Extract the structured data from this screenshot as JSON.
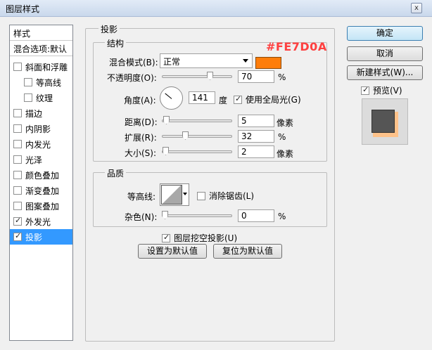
{
  "window": {
    "title": "图层样式",
    "close_label": "x"
  },
  "style_list": {
    "header": "样式",
    "blend_options": "混合选项:默认",
    "items": [
      {
        "label": "斜面和浮雕",
        "checked": false,
        "indent": false
      },
      {
        "label": "等高线",
        "checked": false,
        "indent": true
      },
      {
        "label": "纹理",
        "checked": false,
        "indent": true
      },
      {
        "label": "描边",
        "checked": false,
        "indent": false
      },
      {
        "label": "内阴影",
        "checked": false,
        "indent": false
      },
      {
        "label": "内发光",
        "checked": false,
        "indent": false
      },
      {
        "label": "光泽",
        "checked": false,
        "indent": false
      },
      {
        "label": "颜色叠加",
        "checked": false,
        "indent": false
      },
      {
        "label": "渐变叠加",
        "checked": false,
        "indent": false
      },
      {
        "label": "图案叠加",
        "checked": false,
        "indent": false
      },
      {
        "label": "外发光",
        "checked": true,
        "indent": false
      },
      {
        "label": "投影",
        "checked": true,
        "indent": false,
        "selected": true
      }
    ]
  },
  "panel": {
    "title": "投影",
    "structure": {
      "title": "结构",
      "blend_mode_label": "混合模式(B):",
      "blend_mode_value": "正常",
      "color_hex": "#fe7d0a",
      "color_annotation": "#FE7D0A",
      "opacity_label": "不透明度(O):",
      "opacity_value": "70",
      "opacity_unit": "%",
      "angle_label": "角度(A):",
      "angle_value": "141",
      "angle_unit": "度",
      "global_light_label": "使用全局光(G)",
      "global_light_checked": true,
      "distance_label": "距离(D):",
      "distance_value": "5",
      "distance_unit": "像素",
      "spread_label": "扩展(R):",
      "spread_value": "32",
      "spread_unit": "%",
      "size_label": "大小(S):",
      "size_value": "2",
      "size_unit": "像素"
    },
    "quality": {
      "title": "品质",
      "contour_label": "等高线:",
      "antialias_label": "消除锯齿(L)",
      "antialias_checked": false,
      "noise_label": "杂色(N):",
      "noise_value": "0",
      "noise_unit": "%"
    },
    "knockout_label": "图层挖空投影(U)",
    "knockout_checked": true,
    "make_default_label": "设置为默认值",
    "reset_default_label": "复位为默认值"
  },
  "buttons": {
    "ok": "确定",
    "cancel": "取消",
    "new_style": "新建样式(W)...",
    "preview_label": "预览(V)",
    "preview_checked": true
  }
}
